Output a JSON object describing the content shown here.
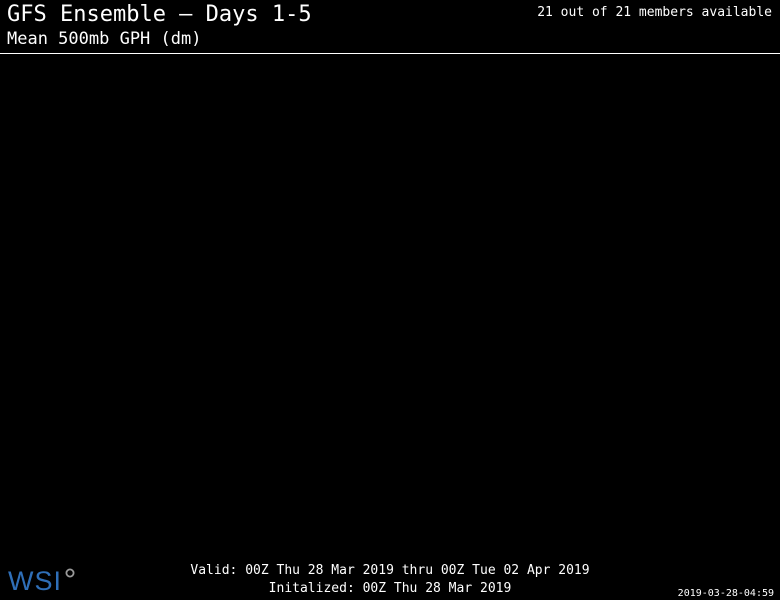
{
  "header": {
    "title": "GFS Ensemble — Days 1-5",
    "subtitle": "Mean 500mb GPH (dm)",
    "members": "21 out of 21 members available"
  },
  "footer": {
    "valid": "Valid: 00Z Thu 28 Mar 2019 thru 00Z Tue 02 Apr 2019",
    "initialized": "Initalized: 00Z Thu 28 Mar 2019",
    "timestamp": "2019-03-28-04:59"
  },
  "logo": {
    "text": "WSI",
    "color": "#2f6fb8",
    "icon": "wsi-mark-icon"
  },
  "colors": {
    "background": "#000000",
    "text": "#ffffff"
  }
}
